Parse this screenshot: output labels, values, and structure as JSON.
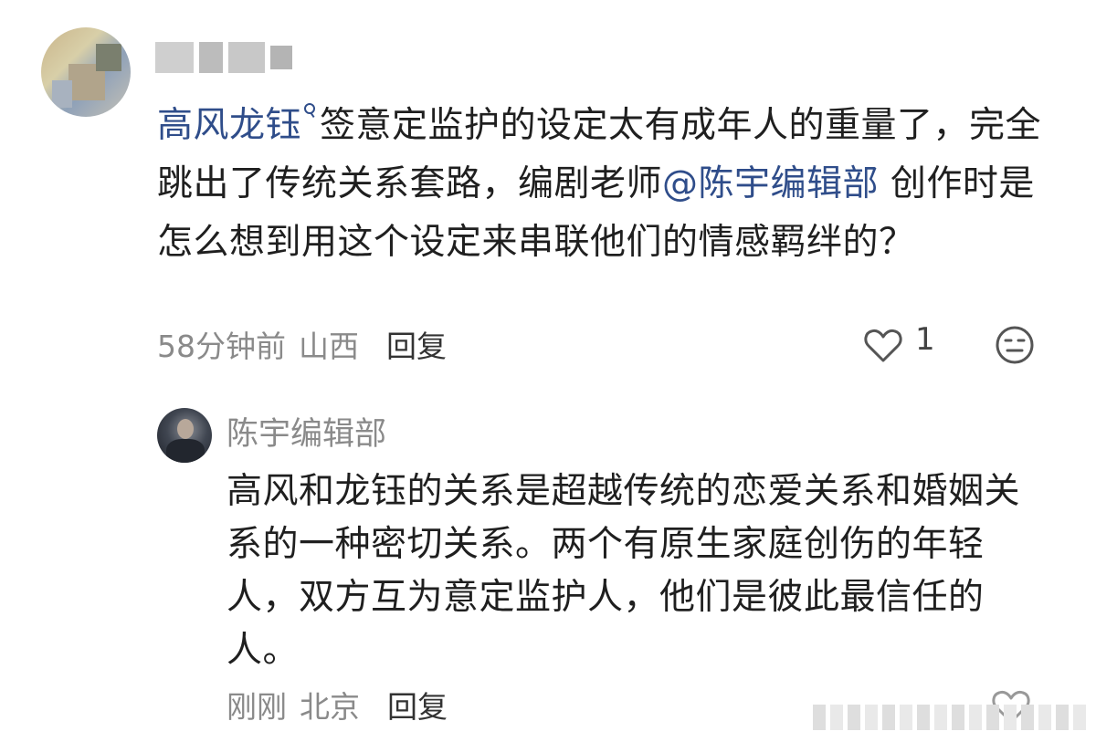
{
  "top_comment": {
    "mention_name": "高风龙钰",
    "text_before_mention": "签意定监护的设定太有成年人的重量了，完全跳出了传统关系套路，编剧老师",
    "mention_user": "@陈宇编辑部",
    "text_after_mention": " 创作时是怎么想到用这个设定来串联他们的情感羁绊的？",
    "time": "58分钟前",
    "location": "山西",
    "reply_label": "回复",
    "like_count": "1"
  },
  "reply": {
    "author": "陈宇编辑部",
    "text": "高风和龙钰的关系是超越传统的恋爱关系和婚姻关系的一种密切关系。两个有原生家庭创伤的年轻人，双方互为意定监护人，他们是彼此最信任的人。",
    "time": "刚刚",
    "location": "北京",
    "reply_label": "回复"
  },
  "colors": {
    "mention": "#2f4d8a",
    "meta_gray": "#8a8a8a",
    "text": "#1f1f1f"
  },
  "icons": {
    "like": "heart-outline-icon",
    "emoji": "neutral-face-icon",
    "search": "search-icon"
  }
}
